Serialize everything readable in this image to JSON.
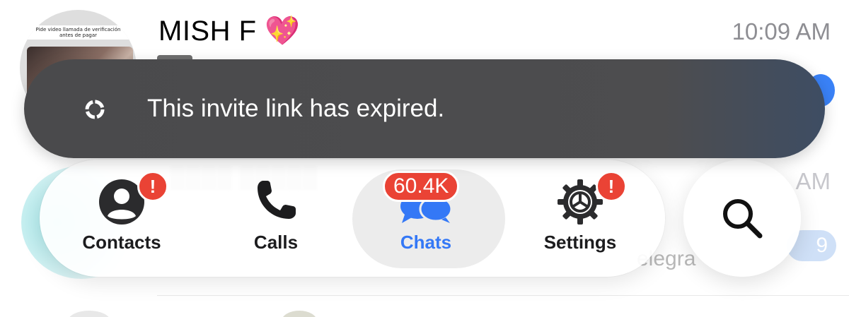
{
  "chat_list": {
    "top_chat": {
      "name": "MISH F 💖",
      "time": "10:09 AM",
      "avatar_caption": "Pide video llamada de verificación antes de pagar"
    },
    "faded_time": "AM",
    "faded_preview": "elegra",
    "faded_badge": "9"
  },
  "toast": {
    "message": "This invite link has expired.",
    "icon": "refresh-icon"
  },
  "tab_bar": {
    "tabs": [
      {
        "label": "Contacts",
        "icon": "person-circle-icon",
        "badge": "!"
      },
      {
        "label": "Calls",
        "icon": "phone-icon",
        "badge": ""
      },
      {
        "label": "Chats",
        "icon": "chat-bubbles-icon",
        "badge": "60.4K",
        "selected": true
      },
      {
        "label": "Settings",
        "icon": "gear-icon",
        "badge": "!"
      }
    ]
  },
  "search": {
    "icon": "search-icon"
  },
  "colors": {
    "accent": "#3478f6",
    "badge": "#ea4335",
    "toast_bg": "#4a4a4c"
  }
}
